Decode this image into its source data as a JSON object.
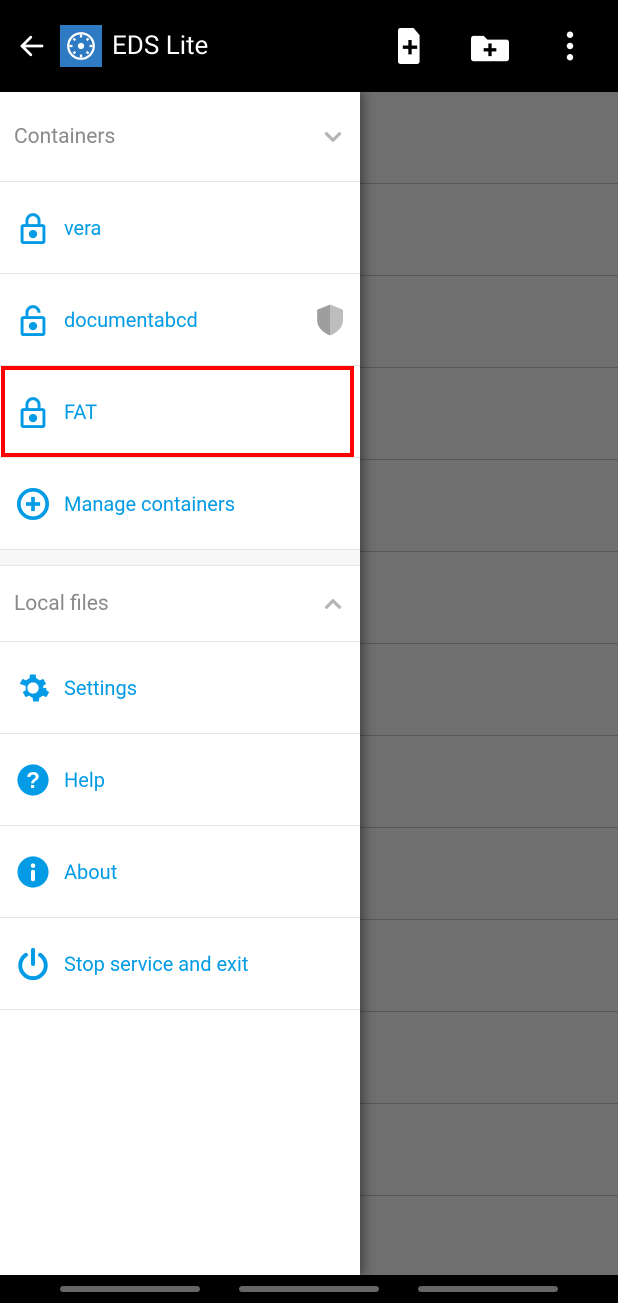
{
  "header": {
    "title": "EDS Lite"
  },
  "sections": {
    "containers": {
      "title": "Containers"
    },
    "localfiles": {
      "title": "Local files"
    }
  },
  "containers": [
    {
      "label": "vera",
      "locked": true,
      "shield": false,
      "highlight": false
    },
    {
      "label": "documentabcd",
      "locked": false,
      "shield": true,
      "highlight": false
    },
    {
      "label": "FAT",
      "locked": true,
      "shield": false,
      "highlight": true
    }
  ],
  "manage": {
    "label": "Manage containers"
  },
  "menu": {
    "settings": "Settings",
    "help": "Help",
    "about": "About",
    "stop": "Stop service and exit"
  },
  "icons": {
    "back": "back-arrow-icon",
    "app": "app-clock-icon",
    "newfile": "new-file-icon",
    "newfolder": "new-folder-icon",
    "overflow": "overflow-icon",
    "lock": "lock-icon",
    "unlock": "unlock-icon",
    "shield": "shield-icon",
    "plus": "plus-circle-icon",
    "settings": "gear-icon",
    "help": "help-icon",
    "about": "info-icon",
    "power": "power-icon",
    "chevdown": "chevron-down-icon",
    "chevup": "chevron-up-icon"
  },
  "colors": {
    "accent": "#039be5",
    "muted": "#8a8a8a",
    "shield": "#9e9e9e"
  }
}
